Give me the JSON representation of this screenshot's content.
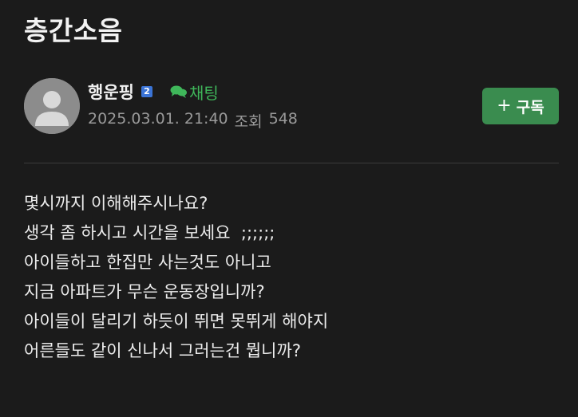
{
  "post": {
    "title": "층간소음",
    "author": "행운핑",
    "level_badge": "2",
    "chat_label": "채팅",
    "date": "2025.03.01. 21:40",
    "views_label": "조회",
    "views_count": "548",
    "subscribe_label": "구독",
    "subscribe_icon": "+",
    "body_lines": [
      "몇시까지 이해해주시나요?",
      "생각 좀 하시고 시간을 보세요  ;;;;;;",
      "아이들하고 한집만 사는것도 아니고",
      "지금 아파트가 무슨 운동장입니까?",
      "아이들이 달리기 하듯이 뛰면 못뛰게 해야지",
      "어른들도 같이 신나서 그러는건 뭡니까?"
    ]
  },
  "icons": {
    "avatar": "default-avatar-icon",
    "chat": "chat-bubbles-icon",
    "subscribe": "plus-icon"
  },
  "colors": {
    "background": "#1b1b1b",
    "accent_green": "#3fb75a",
    "button_green": "#3a8c4f",
    "badge_blue": "#3b74d6"
  }
}
